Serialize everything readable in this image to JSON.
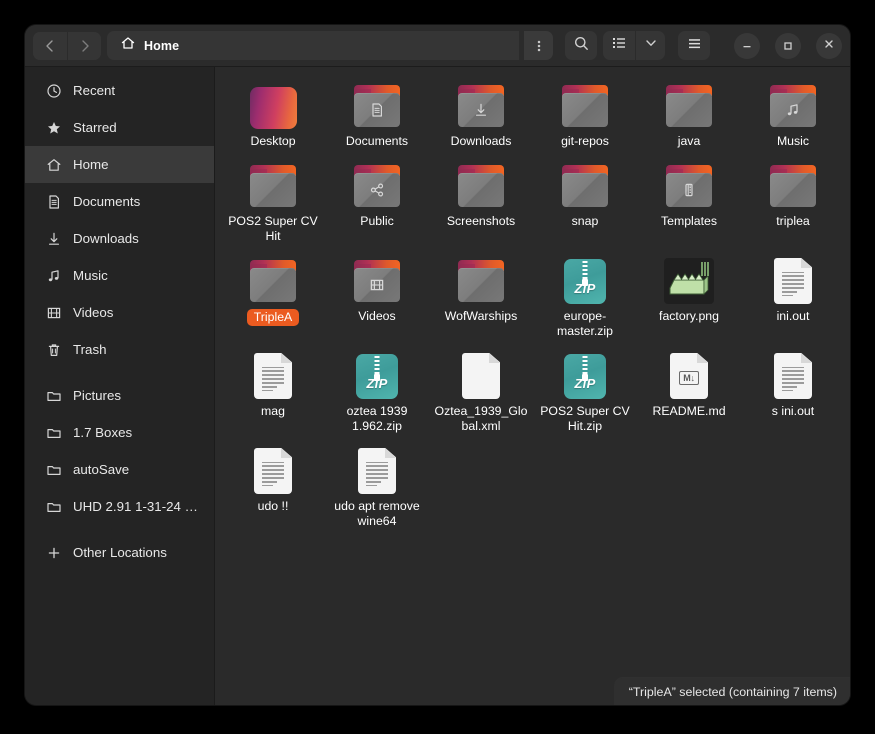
{
  "window": {
    "title": "Home",
    "path_icon": "home-icon"
  },
  "toolbar": {
    "back_label": "‹",
    "forward_label": "›",
    "path_menu_label": "⋮",
    "search_label": "search-icon",
    "view_list_label": "list-view-icon",
    "view_dropdown_label": "chevron-down-icon",
    "menu_label": "hamburger-icon",
    "minimize_label": "–",
    "maximize_label": "□",
    "close_label": "✕"
  },
  "sidebar": {
    "items": [
      {
        "label": "Recent",
        "icon": "clock-icon",
        "active": false
      },
      {
        "label": "Starred",
        "icon": "star-icon",
        "active": false
      },
      {
        "label": "Home",
        "icon": "home-icon",
        "active": true
      },
      {
        "label": "Documents",
        "icon": "document-icon",
        "active": false
      },
      {
        "label": "Downloads",
        "icon": "download-icon",
        "active": false
      },
      {
        "label": "Music",
        "icon": "music-icon",
        "active": false
      },
      {
        "label": "Videos",
        "icon": "video-icon",
        "active": false
      },
      {
        "label": "Trash",
        "icon": "trash-icon",
        "active": false
      }
    ],
    "bookmarks": [
      {
        "label": "Pictures",
        "icon": "folder-icon"
      },
      {
        "label": "1.7 Boxes",
        "icon": "folder-icon"
      },
      {
        "label": "autoSave",
        "icon": "folder-icon"
      },
      {
        "label": "UHD 2.91 1-31-24 …",
        "icon": "folder-icon"
      }
    ],
    "other_locations": {
      "label": "Other Locations",
      "icon": "plus-icon"
    }
  },
  "files": [
    {
      "name": "Desktop",
      "type": "desktop",
      "selected": false
    },
    {
      "name": "Documents",
      "type": "folder",
      "glyph": "document-icon",
      "selected": false
    },
    {
      "name": "Downloads",
      "type": "folder",
      "glyph": "download-icon",
      "selected": false
    },
    {
      "name": "git-repos",
      "type": "folder",
      "glyph": "",
      "selected": false
    },
    {
      "name": "java",
      "type": "folder",
      "glyph": "",
      "selected": false
    },
    {
      "name": "Music",
      "type": "folder",
      "glyph": "music-icon",
      "selected": false
    },
    {
      "name": "POS2 Super CV Hit",
      "type": "folder",
      "glyph": "",
      "selected": false
    },
    {
      "name": "Public",
      "type": "folder",
      "glyph": "share-icon",
      "selected": false
    },
    {
      "name": "Screenshots",
      "type": "folder",
      "glyph": "",
      "selected": false
    },
    {
      "name": "snap",
      "type": "folder",
      "glyph": "",
      "selected": false
    },
    {
      "name": "Templates",
      "type": "folder",
      "glyph": "template-icon",
      "selected": false
    },
    {
      "name": "triplea",
      "type": "folder",
      "glyph": "",
      "selected": false
    },
    {
      "name": "TripleA",
      "type": "folder",
      "glyph": "",
      "selected": true
    },
    {
      "name": "Videos",
      "type": "folder",
      "glyph": "film-icon",
      "selected": false
    },
    {
      "name": "WofWarships",
      "type": "folder",
      "glyph": "",
      "selected": false
    },
    {
      "name": "europe-master.zip",
      "type": "zip",
      "badge": "ZiP",
      "selected": false
    },
    {
      "name": "factory.png",
      "type": "png",
      "selected": false
    },
    {
      "name": "ini.out",
      "type": "doc",
      "selected": false
    },
    {
      "name": "mag",
      "type": "doc",
      "selected": false
    },
    {
      "name": "oztea 1939 1.962.zip",
      "type": "zip",
      "badge": "ZiP",
      "selected": false
    },
    {
      "name": "Oztea_1939_Global.xml",
      "type": "xml",
      "badge": "</>",
      "selected": false
    },
    {
      "name": "POS2 Super CV Hit.zip",
      "type": "zip",
      "badge": "ZiP",
      "selected": false
    },
    {
      "name": "README.md",
      "type": "md",
      "badge": "M↓",
      "selected": false
    },
    {
      "name": "s ini.out",
      "type": "doc",
      "selected": false
    },
    {
      "name": "udo !!",
      "type": "doc",
      "selected": false
    },
    {
      "name": "udo apt remove wine64",
      "type": "doc",
      "selected": false
    }
  ],
  "statusbar": {
    "text": "“TripleA” selected  (containing 7 items)"
  },
  "colors": {
    "accent": "#eb5b20",
    "window_bg": "#242424",
    "header_bg": "#2b2b2b",
    "content_bg": "#2a2a2a",
    "sidebar_active": "#3a3a3a",
    "zip_teal": "#45a5a2",
    "xml_pink": "#e255b4"
  }
}
